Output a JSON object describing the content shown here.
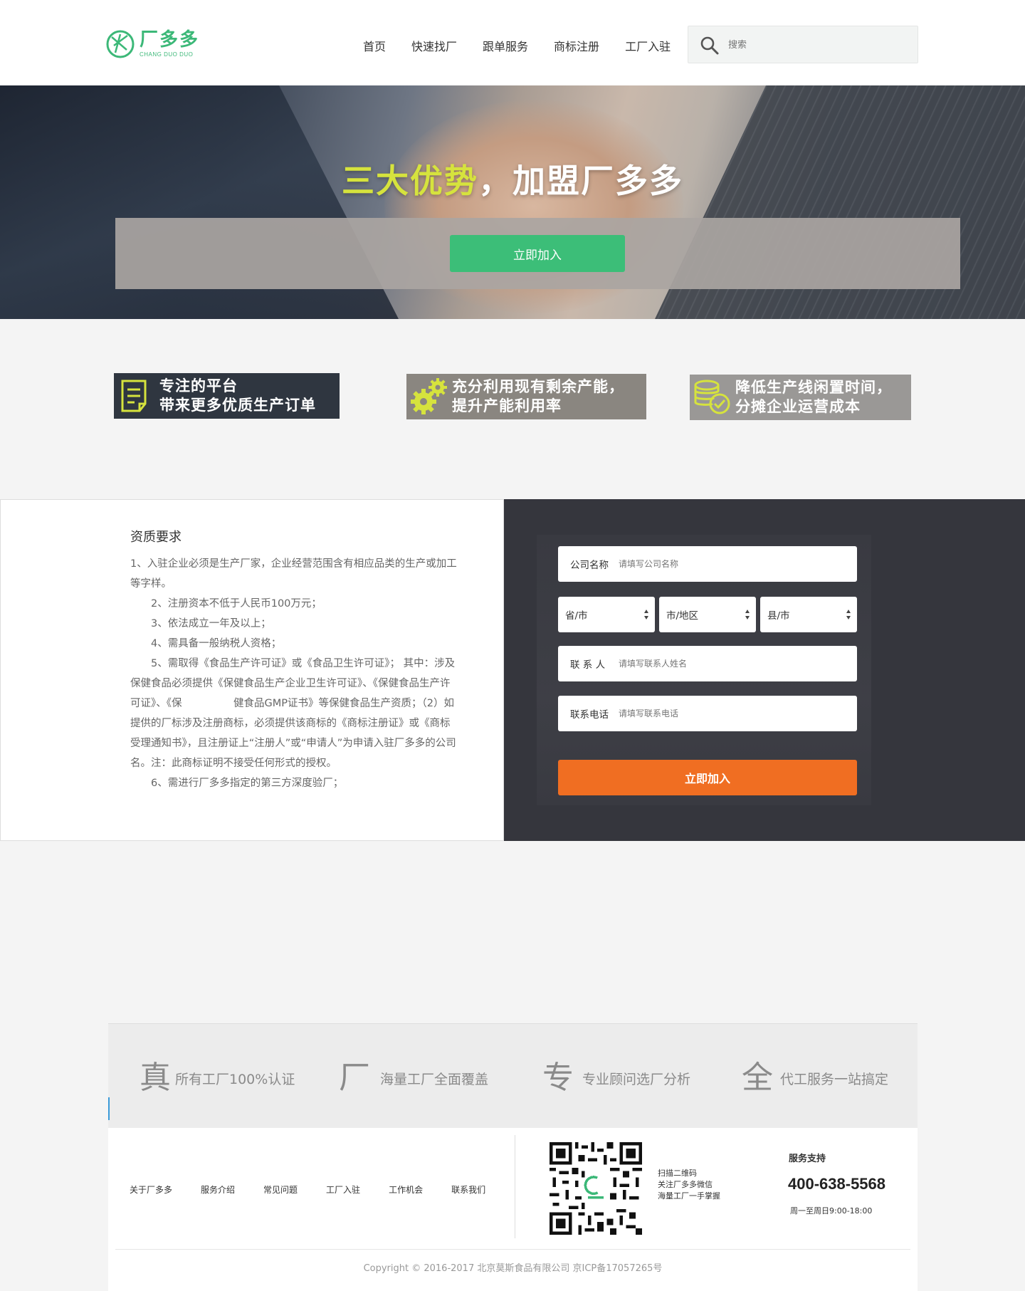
{
  "header": {
    "logo_text": "厂多多",
    "logo_sub": "CHANG DUO DUO",
    "nav": [
      {
        "label": "首页"
      },
      {
        "label": "快速找厂"
      },
      {
        "label": "跟单服务"
      },
      {
        "label": "商标注册"
      },
      {
        "label": "工厂入驻"
      }
    ],
    "search": {
      "placeholder": "搜索",
      "icon": "search-icon"
    }
  },
  "hero": {
    "title_highlight": "三大优势",
    "title_rest": "，加盟厂多多",
    "join_label": "立即加入"
  },
  "features": [
    {
      "line1": "专注的平台",
      "line2": "带来更多优质生产订单",
      "icon": "document-icon",
      "icon_color": "#d6e33d"
    },
    {
      "line1": "充分利用现有剩余产能，",
      "line2": "提升产能利用率",
      "icon": "gears-icon",
      "icon_color": "#d6e33d"
    },
    {
      "line1": "降低生产线闲置时间，",
      "line2": "分摊企业运营成本",
      "icon": "coins-check-icon",
      "icon_color": "#d6e33d"
    }
  ],
  "requirements": {
    "title": "资质要求",
    "items": [
      "1、入驻企业必须是生产厂家，企业经营范围含有相应品类的生产或加工等字样。",
      "　　2、注册资本不低于人民币100万元；",
      "　　3、依法成立一年及以上；",
      "　　4、需具备一般纳税人资格；",
      "　　5、需取得《食品生产许可证》或《食品卫生许可证》； 其中：涉及保健食品必须提供《保健食品生产企业卫生许可证》、《保健食品生产许可证》、《保　　　　　健食品GMP证书》等保健食品生产资质；（2）如提供的厂标涉及注册商标，必须提供该商标的《商标注册证》或《商标受理通知书》，且注册证上“注册人”或“申请人”为申请入驻厂多多的公司名。注：此商标证明不接受任何形式的授权。",
      "　　6、需进行厂多多指定的第三方深度验厂；"
    ]
  },
  "form": {
    "company": {
      "label": "公司名称",
      "placeholder": "请填写公司名称"
    },
    "province": "省/市",
    "city": "市/地区",
    "county": "县/市",
    "contact": {
      "label": "联 系 人",
      "placeholder": "请填写联系人姓名"
    },
    "phone": {
      "label": "联系电话",
      "placeholder": "请填写联系电话"
    },
    "submit_label": "立即加入"
  },
  "advantages": [
    {
      "char": "真",
      "text": "所有工厂100%认证"
    },
    {
      "char": "厂",
      "text": "海量工厂全面覆盖"
    },
    {
      "char": "专",
      "text": "专业顾问选厂分析"
    },
    {
      "char": "全",
      "text": "代工服务一站搞定"
    }
  ],
  "footer": {
    "links": [
      "关于厂多多",
      "服务介绍",
      "常见问题",
      "工厂入驻",
      "工作机会",
      "联系我们"
    ],
    "qr_lines": [
      "扫描二维码",
      "关注厂多多微信",
      "海量工厂一手掌握"
    ],
    "support_title": "服务支持",
    "support_phone": "400-638-5568",
    "support_hours": "周一至周日9:00-18:00",
    "copyright": "Copyright © 2016-2017 北京莫斯食品有限公司 京ICP备17057265号"
  },
  "colors": {
    "brand_green": "#3cb878",
    "join_green": "#3cbe78",
    "submit_orange": "#f06e22",
    "feature_yellow": "#d6e33d",
    "form_bg": "#35363d"
  }
}
